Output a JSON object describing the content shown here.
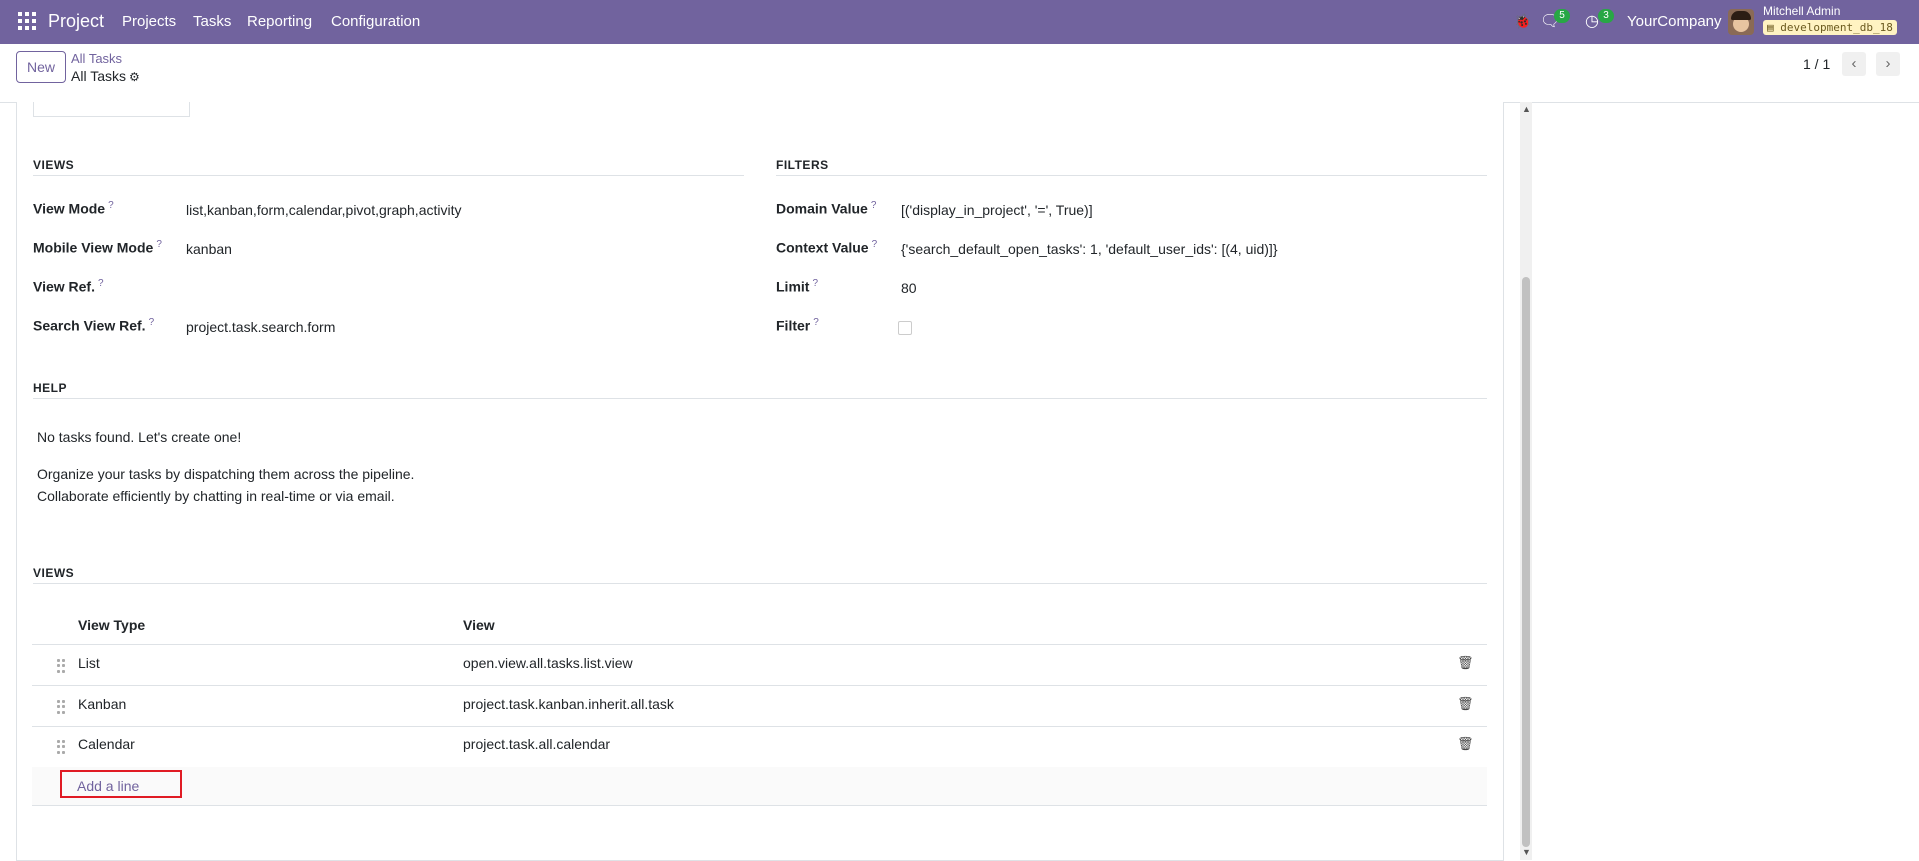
{
  "topbar": {
    "brand": "Project",
    "menu": [
      "Projects",
      "Tasks",
      "Reporting",
      "Configuration"
    ],
    "chat_count": "5",
    "activity_count": "3",
    "company": "YourCompany",
    "user_name": "Mitchell Admin",
    "db_name": "development_db_18",
    "icons": [
      "apps-grid-icon",
      "bug-icon",
      "chat-icon",
      "clock-icon"
    ]
  },
  "control": {
    "new_label": "New",
    "breadcrumb_parent": "All Tasks",
    "breadcrumb_current": "All Tasks",
    "pager": "1 / 1"
  },
  "views_section": {
    "title": "VIEWS",
    "fields": [
      {
        "label": "View Mode",
        "value": "list,kanban,form,calendar,pivot,graph,activity"
      },
      {
        "label": "Mobile View Mode",
        "value": "kanban"
      },
      {
        "label": "View Ref.",
        "value": ""
      },
      {
        "label": "Search View Ref.",
        "value": "project.task.search.form"
      }
    ]
  },
  "filters_section": {
    "title": "FILTERS",
    "fields": [
      {
        "label": "Domain Value",
        "value": "[('display_in_project', '=', True)]"
      },
      {
        "label": "Context Value",
        "value": "{'search_default_open_tasks': 1, 'default_user_ids': [(4, uid)]}"
      },
      {
        "label": "Limit",
        "value": "80"
      },
      {
        "label": "Filter",
        "value": ""
      }
    ]
  },
  "help_section": {
    "title": "HELP",
    "line1": "No tasks found. Let's create one!",
    "line2": "Organize your tasks by dispatching them across the pipeline.",
    "line3": "Collaborate efficiently by chatting in real-time or via email."
  },
  "views_table": {
    "title": "VIEWS",
    "headers": [
      "View Type",
      "View"
    ],
    "rows": [
      {
        "type": "List",
        "view": "open.view.all.tasks.list.view"
      },
      {
        "type": "Kanban",
        "view": "project.task.kanban.inherit.all.task"
      },
      {
        "type": "Calendar",
        "view": "project.task.all.calendar"
      }
    ],
    "add_line": "Add a line"
  },
  "help_mark": "?"
}
